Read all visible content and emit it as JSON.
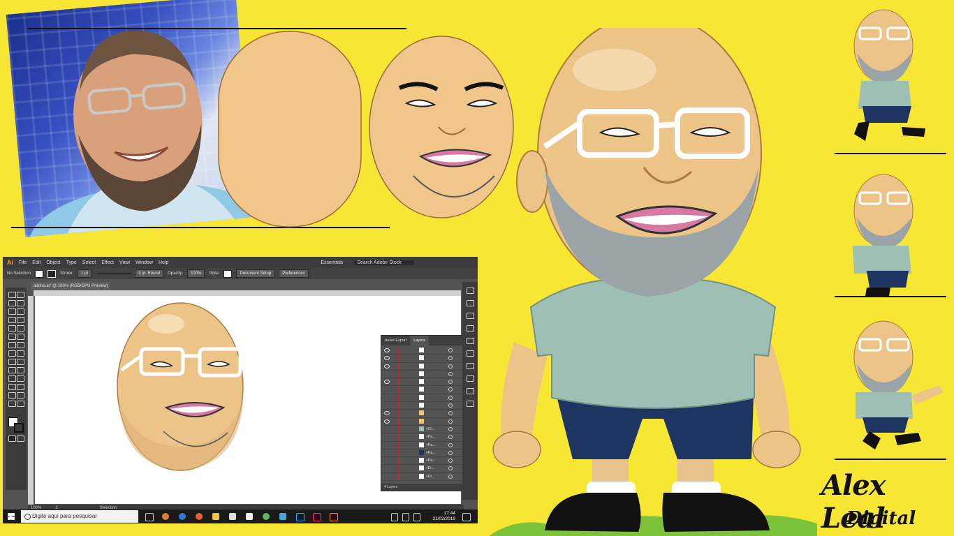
{
  "menu": {
    "logo": "Ai",
    "items": [
      "File",
      "Edit",
      "Object",
      "Type",
      "Select",
      "Effect",
      "View",
      "Window",
      "Help"
    ],
    "workspace": "Essentials",
    "search_placeholder": "Search Adobe Stock"
  },
  "control_bar": {
    "selection": "No Selection",
    "stroke_label": "Stroke:",
    "stroke_value": "1 pt",
    "brush": "3 pt. Round",
    "opacity_label": "Opacity:",
    "opacity_value": "100%",
    "style_label": "Style:",
    "document_setup": "Document Setup",
    "preferences": "Preferences"
  },
  "document": {
    "tab_title": "adrino.ai* @ 100% (RGB/GPU Preview)",
    "zoom": "100%",
    "artboard": "2",
    "status_tool": "Selection"
  },
  "layers_panel": {
    "tabs": [
      "Asset Export",
      "Layers"
    ],
    "rows": [
      "",
      "",
      "",
      "",
      "",
      "",
      "",
      "",
      "",
      "",
      "<Cl...",
      "<Pa...",
      "<Pa...",
      "<Pa...",
      "<Pa...",
      "<El...",
      "<Gr..."
    ],
    "footer": "4 Layers"
  },
  "taskbar": {
    "search_placeholder": "Digite aqui para pesquisar",
    "time": "17:44",
    "date": "21/02/2019"
  },
  "logo": {
    "name": "Alex Leal",
    "tagline": "Digital"
  },
  "colors": {
    "background": "#f7e634",
    "skin": "#edc488",
    "shirt": "#9dbfb4",
    "shorts": "#1e3562",
    "ai_accent": "#ff9a00"
  }
}
